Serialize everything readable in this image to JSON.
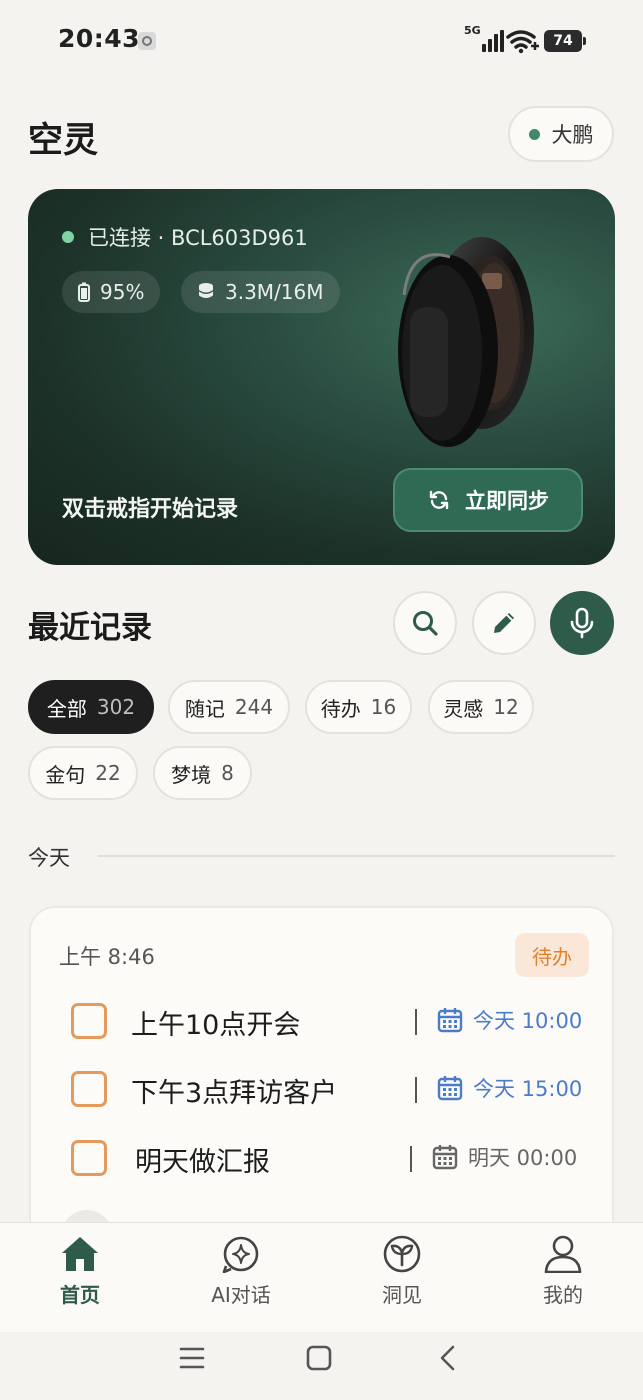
{
  "status_bar": {
    "time": "20:43",
    "network": "5G",
    "battery": "74"
  },
  "header": {
    "app_title": "空灵",
    "user_name": "大鹏"
  },
  "device": {
    "connection_status": "已连接 · BCL603D961",
    "battery_level": "95%",
    "storage": "3.3M/16M",
    "hint": "双击戒指开始记录",
    "sync_label": "立即同步",
    "colors": {
      "connected_dot": "#7fd2a6",
      "card_bg": "#1c3128",
      "sync_bg": "#2f6a55"
    }
  },
  "recent": {
    "title": "最近记录",
    "filters": [
      {
        "label": "全部",
        "count": "302",
        "active": true
      },
      {
        "label": "随记",
        "count": "244",
        "active": false
      },
      {
        "label": "待办",
        "count": "16",
        "active": false
      },
      {
        "label": "灵感",
        "count": "12",
        "active": false
      },
      {
        "label": "金句",
        "count": "22",
        "active": false
      },
      {
        "label": "梦境",
        "count": "8",
        "active": false
      }
    ],
    "day_label": "今天"
  },
  "record": {
    "time": "上午 8:46",
    "type_badge": "待办",
    "todos": [
      {
        "text": "上午10点开会",
        "due": "今天 10:00",
        "due_style": "blue"
      },
      {
        "text": "下午3点拜访客户",
        "due": "今天 15:00",
        "due_style": "blue"
      },
      {
        "text": "明天做汇报",
        "due": "明天 00:00",
        "due_style": "gray"
      }
    ]
  },
  "bottom_nav": [
    {
      "label": "首页",
      "icon": "home-icon",
      "active": true
    },
    {
      "label": "AI对话",
      "icon": "ai-chat-icon",
      "active": false
    },
    {
      "label": "洞见",
      "icon": "sprout-icon",
      "active": false
    },
    {
      "label": "我的",
      "icon": "profile-icon",
      "active": false
    }
  ],
  "colors": {
    "accent": "#2f5b4b",
    "todo_orange": "#e59a5c",
    "due_blue": "#4a7cc7",
    "background": "#f4f3ef"
  }
}
